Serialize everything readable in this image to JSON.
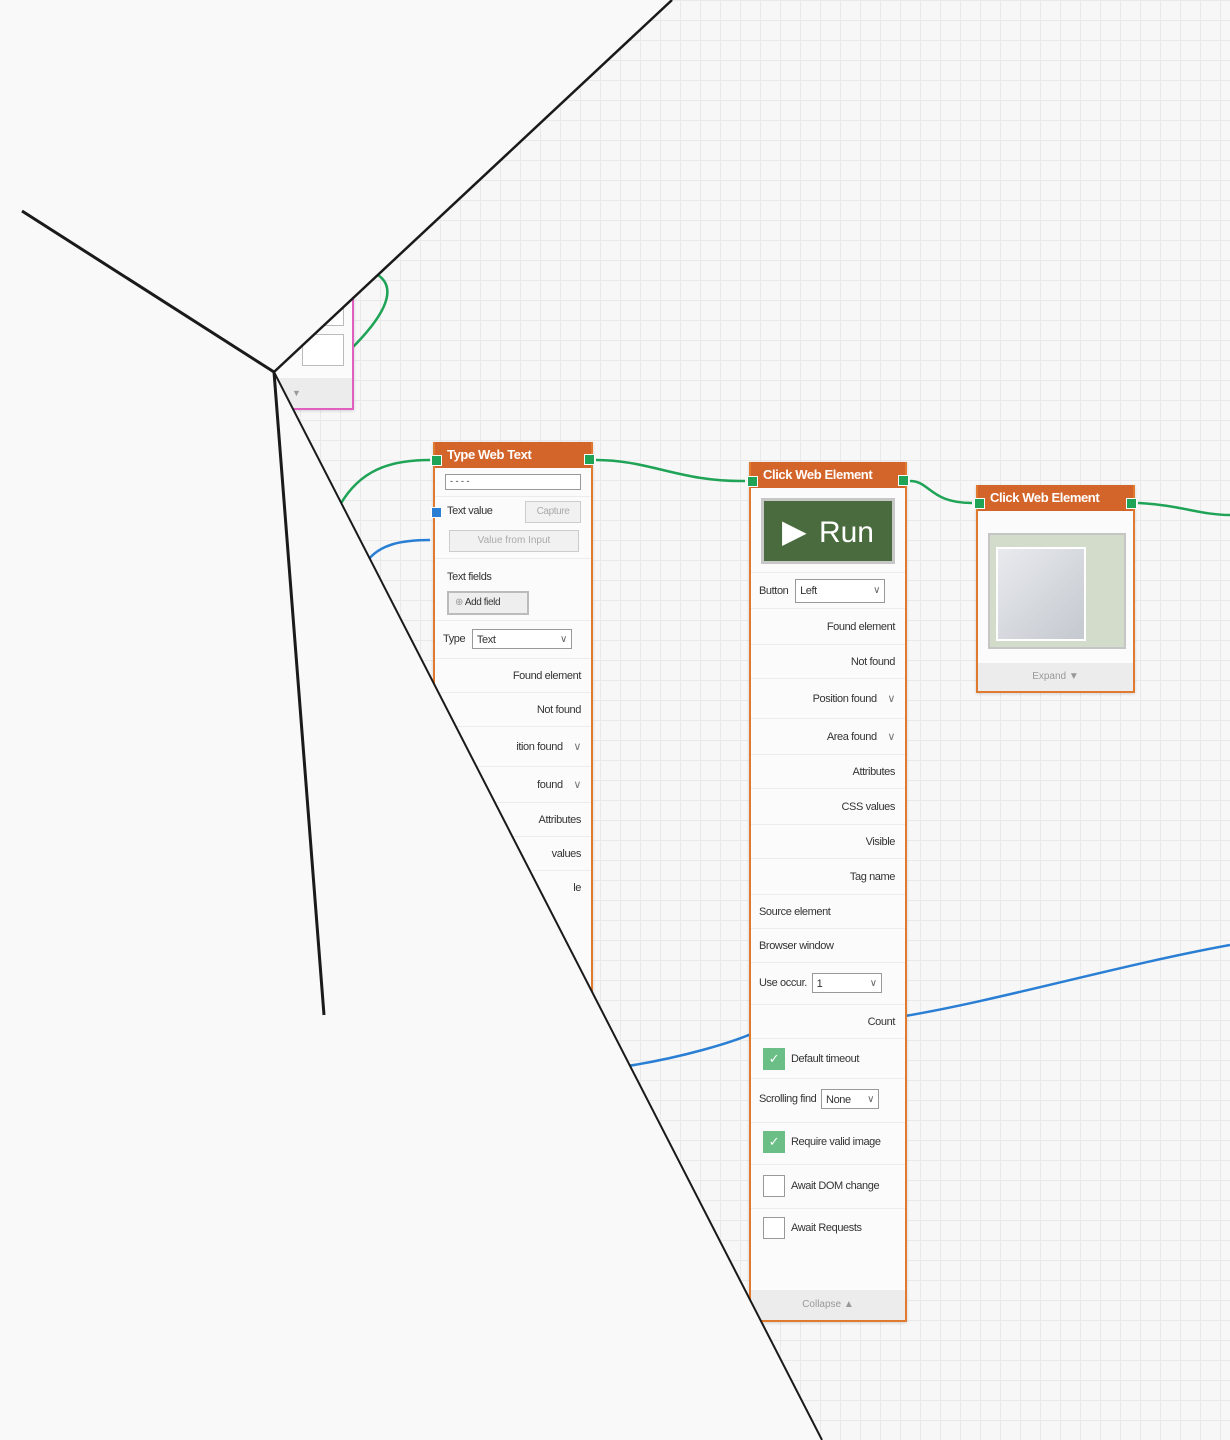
{
  "nodes": {
    "type_web_text": {
      "title": "Type Web Text",
      "text_input": "- - - -",
      "text_value_label": "Text value",
      "capture_label": "Capture",
      "value_from_input_label": "Value from Input",
      "text_fields_label": "Text fields",
      "add_field_label": "Add field",
      "type_label": "Type",
      "type_value": "Text",
      "found_element": "Found element",
      "not_found": "Not found",
      "position_found": "ition found",
      "area_found": "found",
      "attributes": "Attributes",
      "css_values": "values",
      "visible": "le"
    },
    "click_web_element_1": {
      "title": "Click Web Element",
      "run_label": "Run",
      "button_label": "Button",
      "button_value": "Left",
      "found_element": "Found element",
      "not_found": "Not found",
      "position_found": "Position found",
      "area_found": "Area found",
      "attributes": "Attributes",
      "css_values": "CSS values",
      "visible": "Visible",
      "tag_name": "Tag name",
      "source_element": "Source element",
      "browser_window": "Browser window",
      "use_occur_label": "Use occur.",
      "use_occur_value": "1",
      "count": "Count",
      "default_timeout": "Default timeout",
      "scrolling_find_label": "Scrolling find",
      "scrolling_find_value": "None",
      "require_valid_image": "Require valid image",
      "await_dom_change": "Await DOM change",
      "await_requests": "Await Requests",
      "collapse_label": "Collapse ▲"
    },
    "click_web_element_2": {
      "title": "Click Web Element",
      "expand_label": "Expand ▼"
    }
  },
  "colors": {
    "node_header": "#d4652a",
    "node_border": "#e07a2f",
    "flow_port": "#1fa356",
    "data_port": "#2a7fd4",
    "run_button": "#4a6b3e",
    "checkbox_on": "#6bbf86",
    "magenta_node_border": "#e060c0"
  },
  "icons": {
    "run": "play-icon",
    "add_field": "plus-icon",
    "dropdown": "chevron-down-icon"
  }
}
